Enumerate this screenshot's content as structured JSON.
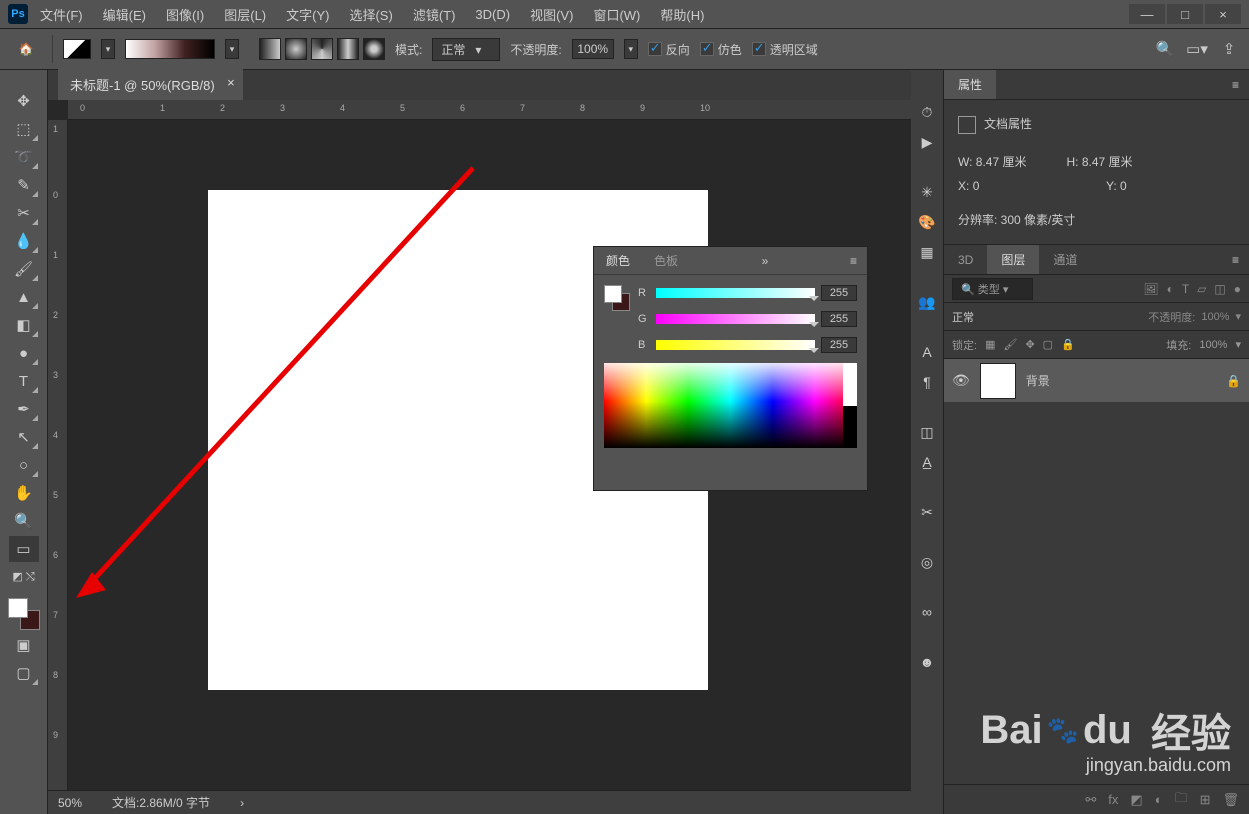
{
  "menubar": {
    "items": [
      "文件(F)",
      "编辑(E)",
      "图像(I)",
      "图层(L)",
      "文字(Y)",
      "选择(S)",
      "滤镜(T)",
      "3D(D)",
      "视图(V)",
      "窗口(W)",
      "帮助(H)"
    ]
  },
  "window_controls": {
    "min": "—",
    "max": "□",
    "close": "×"
  },
  "optbar": {
    "mode_label": "模式:",
    "mode_value": "正常",
    "opacity_label": "不透明度:",
    "opacity_value": "100%",
    "chk_reverse": "反向",
    "chk_dither": "仿色",
    "chk_trans": "透明区域"
  },
  "doc": {
    "tab": "未标题-1 @ 50%(RGB/8)",
    "close": "×"
  },
  "ruler_h": [
    "0",
    "1",
    "2",
    "3",
    "4",
    "5",
    "6",
    "7",
    "8",
    "9",
    "10"
  ],
  "ruler_v": [
    "1",
    "0",
    "1",
    "2",
    "3",
    "4",
    "5",
    "6",
    "7",
    "8",
    "9"
  ],
  "status": {
    "zoom": "50%",
    "info": "文档:2.86M/0 字节",
    "arrow": "›"
  },
  "color_panel": {
    "tab_color": "颜色",
    "tab_swatch": "色板",
    "collapse": "»",
    "r_label": "R",
    "g_label": "G",
    "b_label": "B",
    "r_value": "255",
    "g_value": "255",
    "b_value": "255"
  },
  "props": {
    "tab": "属性",
    "title": "文档属性",
    "w_label": "W:",
    "w_value": "8.47 厘米",
    "h_label": "H:",
    "h_value": "8.47 厘米",
    "x_label": "X:",
    "x_value": "0",
    "y_label": "Y:",
    "y_value": "0",
    "res": "分辨率: 300 像素/英寸"
  },
  "layers": {
    "tab_3d": "3D",
    "tab_layers": "图层",
    "tab_channels": "通道",
    "filter_prefix": "🔍",
    "filter_label": "类型",
    "blend_mode": "正常",
    "opacity_label": "不透明度:",
    "opacity_value": "100%",
    "lock_label": "锁定:",
    "fill_label": "填充:",
    "fill_value": "100%",
    "layer_name": "背景"
  },
  "watermark": {
    "big1": "Bai",
    "big2": "du",
    "big3": "经验",
    "small": "jingyan.baidu.com"
  }
}
